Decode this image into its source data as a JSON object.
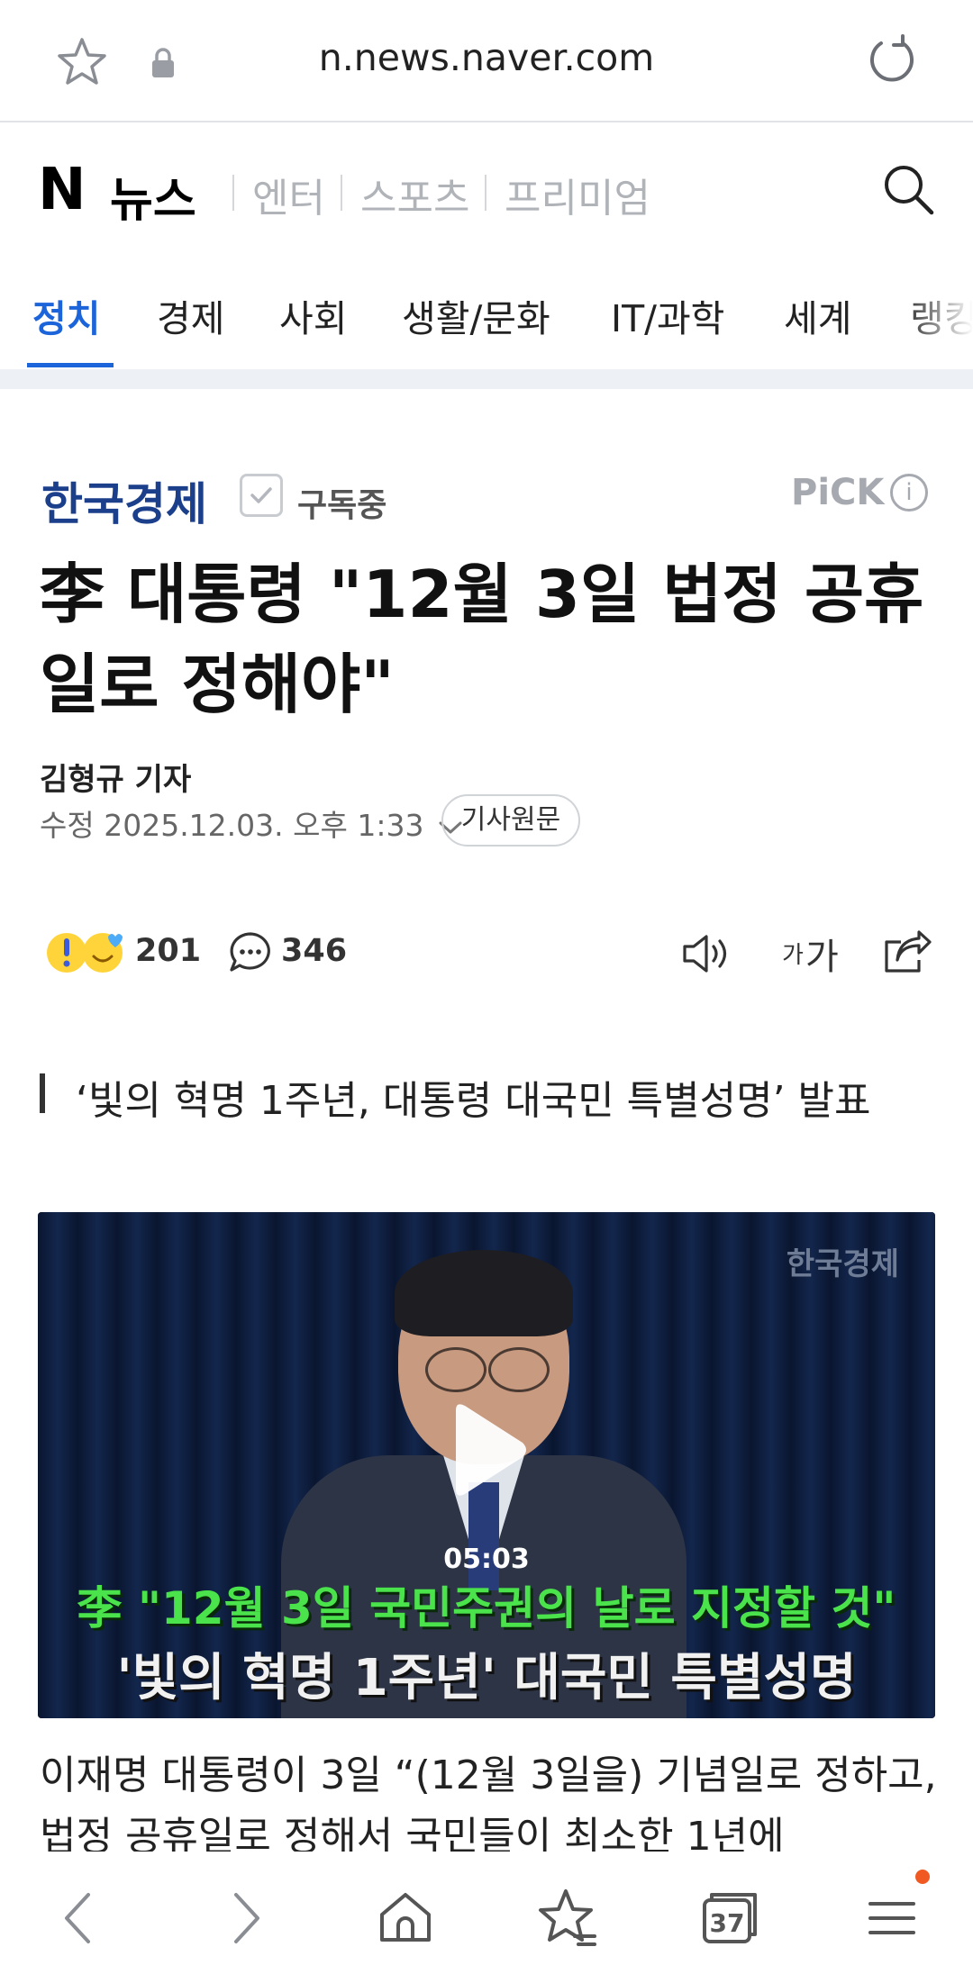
{
  "browser": {
    "url": "n.news.naver.com",
    "tab_count": "37"
  },
  "header": {
    "logo_n": "N",
    "logo_news": "뉴스",
    "sections": [
      "엔터",
      "스포츠",
      "프리미엄"
    ]
  },
  "tabs": [
    {
      "label": "정치",
      "active": true
    },
    {
      "label": "경제"
    },
    {
      "label": "사회"
    },
    {
      "label": "생활/문화"
    },
    {
      "label": "IT/과학"
    },
    {
      "label": "세계"
    },
    {
      "label": "랭킹"
    }
  ],
  "article": {
    "press": "한국경제",
    "subscribe_label": "구독중",
    "pick_label": "PiCK",
    "headline": "李 대통령 \"12월 3일 법정 공휴일로 정해야\"",
    "reporter": "김형규 기자",
    "date": "수정 2025.12.03. 오후 1:33",
    "original_button": "기사원문",
    "reaction_count": "201",
    "comment_count": "346",
    "font_size_label_small": "가",
    "font_size_label_large": "가",
    "subheading": "‘빛의 혁명 1주년, 대통령 대국민 특별성명’ 발표",
    "video": {
      "watermark": "한국경제",
      "duration": "05:03",
      "caption_line1": "李 \"12월 3일 국민주권의 날로 지정할 것\"",
      "caption_line2": "'빛의 혁명 1주년' 대국민 특별성명"
    },
    "body": "이재명 대통령이 3일 “(12월 3일을) 기념일로 정하고, 법정 공휴일로 정해서 국민들이 최소한 1년에"
  },
  "colors": {
    "accent": "#1b64da",
    "press": "#1b3f8b",
    "caption_green": "#4be34b",
    "notification_dot": "#f05a22"
  }
}
